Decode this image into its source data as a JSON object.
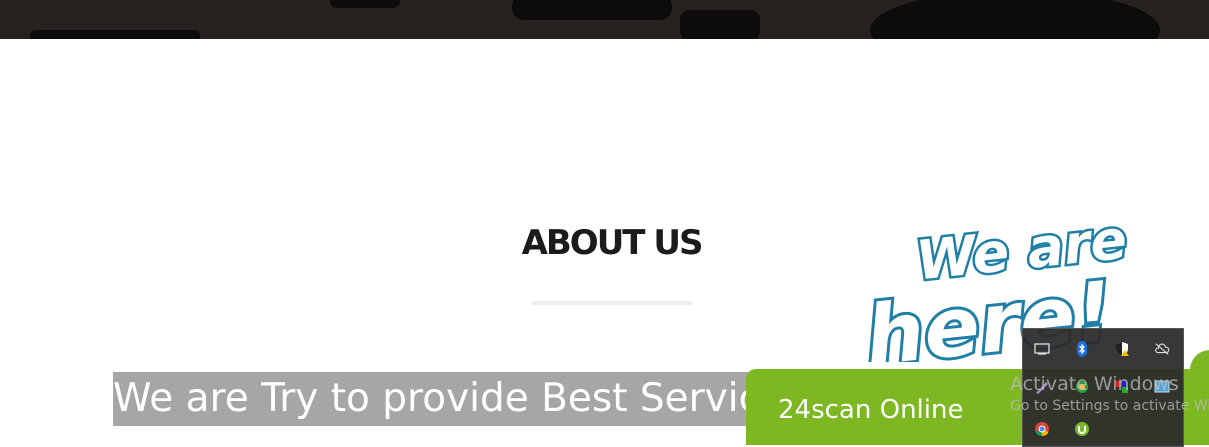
{
  "hero": {
    "background_color": "#26221f"
  },
  "about": {
    "heading": "ABOUT US"
  },
  "tagline": {
    "text": "We are Try to provide Best Service"
  },
  "chat_widget": {
    "badge_line1": "We are",
    "badge_line2": "here!",
    "status_label": "24scan Online",
    "accent_color": "#7db822",
    "badge_color": "#1f7fa6"
  },
  "system_tray": {
    "icons": [
      "keyboard-icon",
      "bluetooth-icon",
      "security-warning-icon",
      "cloud-offline-icon",
      "pen-icon",
      "network-icon",
      "tool-icon",
      "display-icon",
      "chrome-icon",
      "utorrent-icon"
    ]
  },
  "windows_watermark": {
    "line1": "Activate Windows",
    "line2": "Go to Settings to activate Windows."
  }
}
